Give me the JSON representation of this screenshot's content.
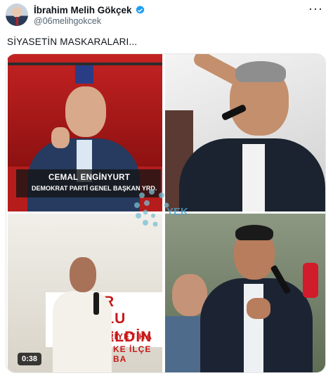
{
  "tweet": {
    "author_name": "İbrahim Melih Gökçek",
    "handle": "@06melihgokcek",
    "more_label": "···",
    "text": "SİYASETİN MASKARALARI...",
    "media": {
      "panel1": {
        "lower_third_name": "CEMAL ENGİNYURT",
        "lower_third_title": "DEMOKRAT PARTİ GENEL BAŞKAN YRD."
      },
      "watermark_text": "YEK",
      "panel3": {
        "sign_line1": "LAR BULU",
        "sign_line2": "Ş GELDİN",
        "sign_line3": "RİYET HA",
        "sign_line4": "KE İLÇE BA",
        "duration": "0:38"
      }
    }
  },
  "colors": {
    "verified": "#1d9bf0",
    "secondary_text": "#536471"
  },
  "icons": {
    "verified": "verified-badge-icon",
    "more": "more-horizontal-icon"
  }
}
